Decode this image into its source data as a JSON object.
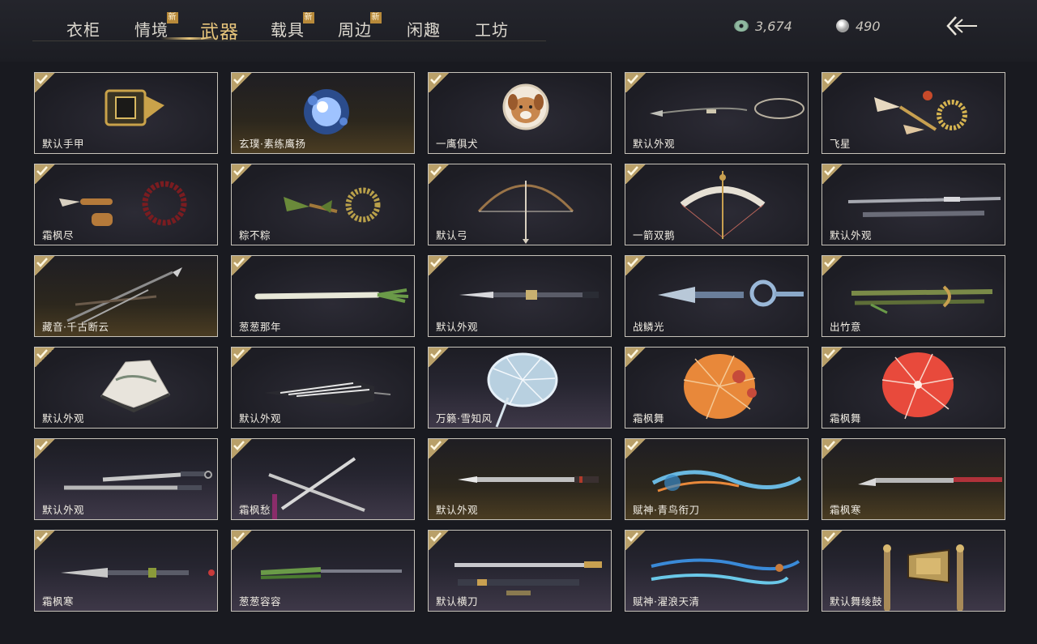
{
  "tabs": [
    {
      "label": "衣柜",
      "new": false
    },
    {
      "label": "情境",
      "new": true
    },
    {
      "label": "武器",
      "new": false,
      "active": true
    },
    {
      "label": "载具",
      "new": true
    },
    {
      "label": "周边",
      "new": true
    },
    {
      "label": "闲趣",
      "new": false
    },
    {
      "label": "工坊",
      "new": false
    }
  ],
  "new_badge_text": "新",
  "currency": {
    "jade_value": "3,674",
    "pearl_value": "490"
  },
  "items": [
    {
      "name": "默认手甲",
      "art": "gauntlet",
      "bg": "plain"
    },
    {
      "name": "玄璞·素练鹰扬",
      "art": "orb",
      "bg": "gold"
    },
    {
      "name": "一鹰俱犬",
      "art": "dog",
      "bg": "plain"
    },
    {
      "name": "默认外观",
      "art": "rope-dart",
      "bg": "plain"
    },
    {
      "name": "飞星",
      "art": "meteor",
      "bg": "plain"
    },
    {
      "name": "霜枫尽",
      "art": "beads",
      "bg": "plain"
    },
    {
      "name": "粽不粽",
      "art": "zongzi",
      "bg": "plain"
    },
    {
      "name": "默认弓",
      "art": "bow",
      "bg": "plain"
    },
    {
      "name": "一箭双鹅",
      "art": "goose-bow",
      "bg": "plain"
    },
    {
      "name": "默认外观",
      "art": "twin-staff",
      "bg": "plain"
    },
    {
      "name": "藏音·千古断云",
      "art": "cross-blades",
      "bg": "gold"
    },
    {
      "name": "葱葱那年",
      "art": "scallion",
      "bg": "plain"
    },
    {
      "name": "默认外观",
      "art": "spear",
      "bg": "plain"
    },
    {
      "name": "战鳞光",
      "art": "dragon-spear",
      "bg": "plain"
    },
    {
      "name": "出竹意",
      "art": "bamboo",
      "bg": "plain"
    },
    {
      "name": "默认外观",
      "art": "fan",
      "bg": "plain"
    },
    {
      "name": "默认外观",
      "art": "closed-fan",
      "bg": "plain"
    },
    {
      "name": "万籁·雪知风",
      "art": "ice-umbrella",
      "bg": "purple"
    },
    {
      "name": "霜枫舞",
      "art": "orange-umbrella",
      "bg": "plain"
    },
    {
      "name": "霜枫舞",
      "art": "red-umbrella",
      "bg": "plain"
    },
    {
      "name": "默认外观",
      "art": "dual-sabers",
      "bg": "purple"
    },
    {
      "name": "霜枫愁",
      "art": "crossed-swords",
      "bg": "purple"
    },
    {
      "name": "默认外观",
      "art": "long-blade",
      "bg": "gold"
    },
    {
      "name": "赋神·青鸟衔刀",
      "art": "spirit-blade",
      "bg": "gold"
    },
    {
      "name": "霜枫寒",
      "art": "red-blade",
      "bg": "gold"
    },
    {
      "name": "霜枫寒",
      "art": "glaive",
      "bg": "purple"
    },
    {
      "name": "葱葱容容",
      "art": "scallion-blade",
      "bg": "purple"
    },
    {
      "name": "默认横刀",
      "art": "hengdao",
      "bg": "purple"
    },
    {
      "name": "赋神·濯浪天清",
      "art": "wave-blade",
      "bg": "purple"
    },
    {
      "name": "默认舞绫鼓",
      "art": "drum",
      "bg": "purple"
    }
  ]
}
